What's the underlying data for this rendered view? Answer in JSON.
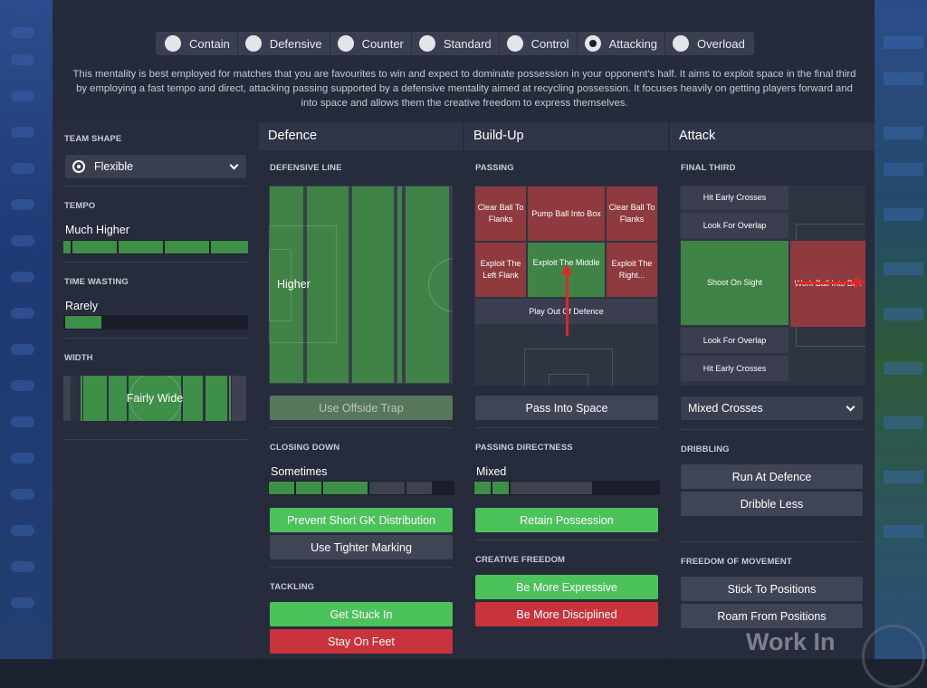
{
  "mentality": {
    "options": [
      "Contain",
      "Defensive",
      "Counter",
      "Standard",
      "Control",
      "Attacking",
      "Overload"
    ],
    "selected": "Attacking",
    "description": "This mentality is best employed for matches that you are favourites to win and expect to dominate possession in your opponent's half. It aims to exploit space in the final third by employing a fast tempo and direct, attacking passing supported by a defensive mentality aimed at recycling possession. It focuses heavily on getting players forward and into space and allows them the creative freedom to express themselves."
  },
  "team": {
    "shape_label": "TEAM SHAPE",
    "shape_value": "Flexible",
    "tempo_label": "TEMPO",
    "tempo_value": "Much Higher",
    "tempo_level": 1.0,
    "timewasting_label": "TIME WASTING",
    "timewasting_value": "Rarely",
    "timewasting_level": 0.2,
    "width_label": "WIDTH",
    "width_value": "Fairly Wide"
  },
  "defence": {
    "title": "Defence",
    "line_label": "DEFENSIVE LINE",
    "line_value": "Higher",
    "offside": "Use Offside Trap",
    "closing_label": "CLOSING DOWN",
    "closing_value": "Sometimes",
    "closing_level": 0.6,
    "gk": "Prevent Short GK Distribution",
    "marking": "Use Tighter Marking",
    "tackling_label": "TACKLING",
    "tackle_in": "Get Stuck In",
    "tackle_feet": "Stay On Feet"
  },
  "buildup": {
    "title": "Build-Up",
    "passing_label": "PASSING",
    "cells": {
      "clear_left": "Clear Ball To Flanks",
      "pump": "Pump Ball Into Box",
      "clear_right": "Clear Ball To Flanks",
      "exploit_left": "Exploit The Left Flank",
      "exploit_middle": "Exploit The Middle",
      "exploit_right": "Exploit The Right...",
      "play_out": "Play Out Of Defence"
    },
    "pass_space": "Pass Into Space",
    "directness_label": "PASSING DIRECTNESS",
    "directness_value": "Mixed",
    "directness_level": 0.3,
    "retain": "Retain Possession",
    "creative_label": "CREATIVE FREEDOM",
    "expressive": "Be More Expressive",
    "disciplined": "Be More Disciplined"
  },
  "attack": {
    "title": "Attack",
    "final_label": "FINAL THIRD",
    "cells": {
      "hit1": "Hit Early Crosses",
      "overlap1": "Look For Overlap",
      "shoot": "Shoot On Sight",
      "work": "Work Ball Into Box",
      "overlap2": "Look For Overlap",
      "hit2": "Hit Early Crosses"
    },
    "crosses": "Mixed Crosses",
    "dribbling_label": "DRIBBLING",
    "run": "Run At Defence",
    "dribble_less": "Dribble Less",
    "freedom_label": "FREEDOM OF MOVEMENT",
    "stick": "Stick To Positions",
    "roam": "Roam From Positions"
  },
  "watermark": "Work In"
}
